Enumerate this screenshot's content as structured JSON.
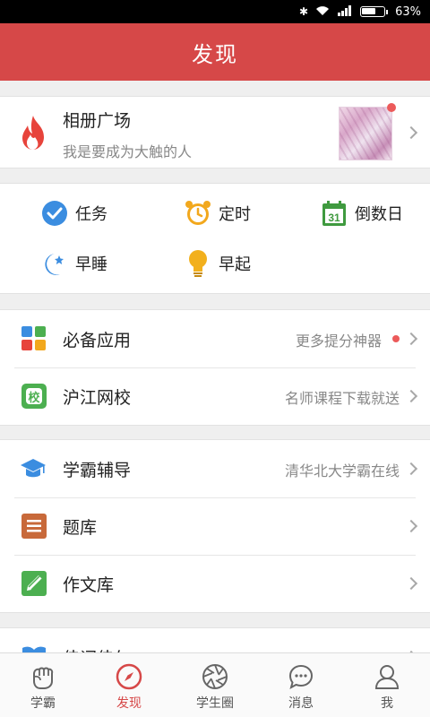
{
  "status_bar": {
    "battery": "63%"
  },
  "header": {
    "title": "发现"
  },
  "album": {
    "title": "相册广场",
    "subtitle": "我是要成为大触的人"
  },
  "tools": [
    {
      "label": "任务",
      "icon": "check-circle-icon"
    },
    {
      "label": "定时",
      "icon": "alarm-clock-icon"
    },
    {
      "label": "倒数日",
      "icon": "calendar-icon",
      "badge": "31"
    },
    {
      "label": "早睡",
      "icon": "moon-star-icon"
    },
    {
      "label": "早起",
      "icon": "lightbulb-icon"
    }
  ],
  "group1": [
    {
      "label": "必备应用",
      "sub": "更多提分神器",
      "icon": "app-grid-icon",
      "has_dot": true
    },
    {
      "label": "沪江网校",
      "sub": "名师课程下载就送",
      "icon": "school-icon",
      "icon_text": "校"
    }
  ],
  "group2": [
    {
      "label": "学霸辅导",
      "sub": "清华北大学霸在线",
      "icon": "graduation-cap-icon"
    },
    {
      "label": "题库",
      "sub": "",
      "icon": "question-bank-icon"
    },
    {
      "label": "作文库",
      "sub": "",
      "icon": "essay-pencil-icon"
    }
  ],
  "group3": [
    {
      "label": "佳词佳句",
      "icon": "book-icon"
    }
  ],
  "tabbar": [
    {
      "label": "学霸",
      "icon": "fist-icon",
      "active": false
    },
    {
      "label": "发现",
      "icon": "compass-icon",
      "active": true
    },
    {
      "label": "学生圈",
      "icon": "aperture-icon",
      "active": false
    },
    {
      "label": "消息",
      "icon": "chat-bubble-icon",
      "active": false
    },
    {
      "label": "我",
      "icon": "person-icon",
      "active": false
    }
  ],
  "colors": {
    "brand": "#d64848",
    "accent_blue": "#3b8de0",
    "accent_orange": "#f2a81d",
    "accent_green": "#4caf50"
  }
}
